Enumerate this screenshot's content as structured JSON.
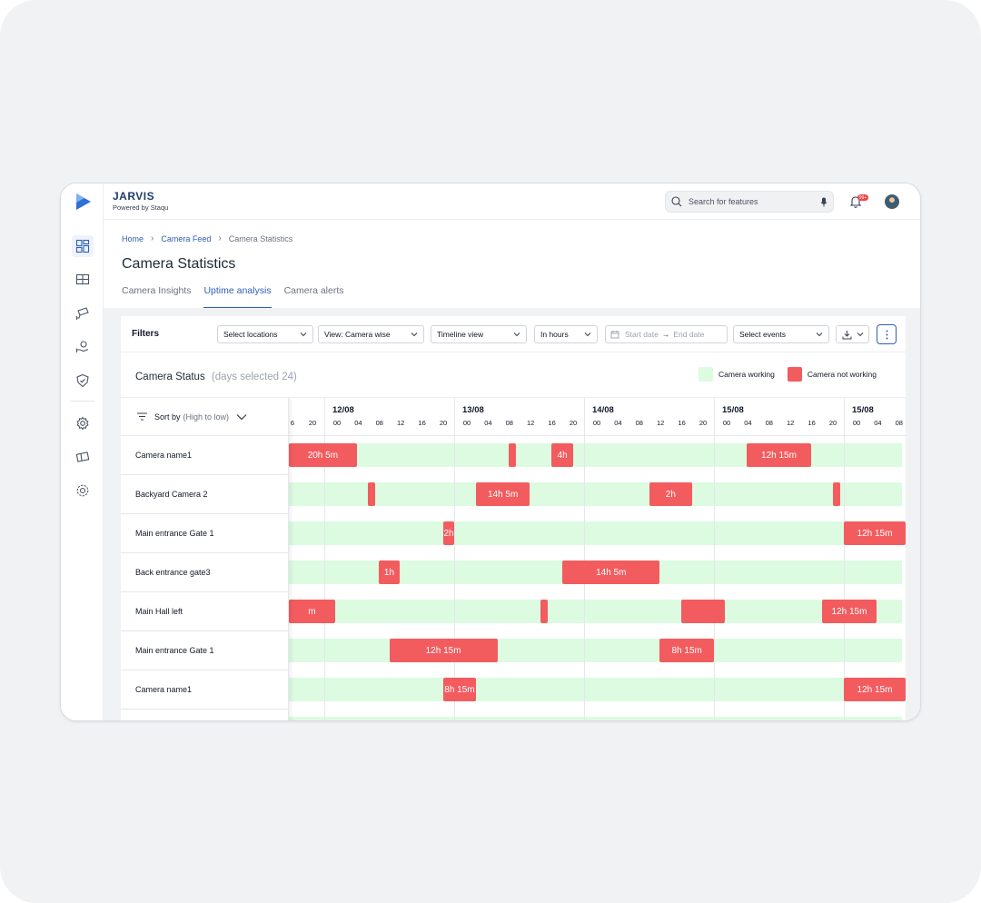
{
  "app": {
    "title": "JARVIS",
    "subtitle": "Powered by Staqu"
  },
  "search": {
    "placeholder": "Search for features"
  },
  "notifications": {
    "badge": "99+"
  },
  "breadcrumb": {
    "home": "Home",
    "feed": "Camera Feed",
    "current": "Camera Statistics"
  },
  "page": {
    "title": "Camera Statistics"
  },
  "tabs": [
    {
      "label": "Camera Insights",
      "active": false
    },
    {
      "label": "Uptime analysis",
      "active": true
    },
    {
      "label": "Camera alerts",
      "active": false
    }
  ],
  "filters": {
    "label": "Filters",
    "locations": "Select locations",
    "view": "View: Camera wise",
    "mode": "Timeline view",
    "unit": "In hours",
    "start_date": "Start date",
    "end_date": "End date",
    "events": "Select events"
  },
  "status": {
    "title": "Camera Status",
    "days": "(days selected 24)"
  },
  "legend": {
    "working": {
      "label": "Camera working",
      "color": "#dcfbe1"
    },
    "not_working": {
      "label": "Camera not working",
      "color": "#f25c5f"
    }
  },
  "sort": {
    "label": "Sort by",
    "order": "(High to low)"
  },
  "timeline": {
    "partial_hours": [
      "6",
      "20"
    ],
    "days": [
      {
        "date": "12/08",
        "hours": [
          "00",
          "04",
          "08",
          "12",
          "16",
          "20"
        ]
      },
      {
        "date": "13/08",
        "hours": [
          "00",
          "04",
          "08",
          "12",
          "16",
          "20"
        ]
      },
      {
        "date": "14/08",
        "hours": [
          "00",
          "04",
          "08",
          "12",
          "16",
          "20"
        ]
      },
      {
        "date": "15/08",
        "hours": [
          "00",
          "04",
          "08",
          "12",
          "16",
          "20"
        ]
      },
      {
        "date": "15/08",
        "hours": [
          "00",
          "04",
          "08"
        ]
      }
    ]
  },
  "cameras": [
    {
      "name": "Camera name1",
      "outages": [
        {
          "start": "11/08 14:00",
          "end": "12/08 06:00",
          "label": "20h 5m"
        },
        {
          "start": "13/08 10:00",
          "end": "13/08 11:00",
          "label": ""
        },
        {
          "start": "13/08 18:00",
          "end": "13/08 22:00",
          "label": "4h"
        },
        {
          "start": "15/08 06:00",
          "end": "15/08 18:00",
          "label": "12h 15m"
        }
      ]
    },
    {
      "name": "Backyard Camera 2",
      "outages": [
        {
          "start": "12/08 08:00",
          "end": "12/08 09:00",
          "label": ""
        },
        {
          "start": "13/08 04:00",
          "end": "13/08 14:00",
          "label": "14h 5m"
        },
        {
          "start": "14/08 12:00",
          "end": "14/08 20:00",
          "label": "2h"
        },
        {
          "start": "15/08 22:00",
          "end": "15/08 23:00",
          "label": ""
        }
      ]
    },
    {
      "name": "Main entrance Gate 1",
      "outages": [
        {
          "start": "12/08 22:00",
          "end": "13/08 00:00",
          "label": "2h"
        },
        {
          "start": "16/08 00:00",
          "end": "16/08 12:00",
          "label": "12h 15m"
        }
      ]
    },
    {
      "name": "Back entrance gate3",
      "outages": [
        {
          "start": "12/08 10:00",
          "end": "12/08 14:00",
          "label": "1h"
        },
        {
          "start": "13/08 20:00",
          "end": "14/08 14:00",
          "label": "14h 5m"
        }
      ]
    },
    {
      "name": "Main Hall left",
      "outages": [
        {
          "start": "11/08 10:00",
          "end": "12/08 02:00",
          "label": "m"
        },
        {
          "start": "13/08 16:00",
          "end": "13/08 17:00",
          "label": ""
        },
        {
          "start": "14/08 18:00",
          "end": "15/08 02:00",
          "label": ""
        },
        {
          "start": "15/08 20:00",
          "end": "16/08 06:00",
          "label": "12h 15m"
        }
      ]
    },
    {
      "name": "Main entrance Gate 1",
      "outages": [
        {
          "start": "12/08 12:00",
          "end": "13/08 08:00",
          "label": "12h 15m"
        },
        {
          "start": "14/08 14:00",
          "end": "15/08 00:00",
          "label": "8h 15m"
        }
      ]
    },
    {
      "name": "Camera name1",
      "outages": [
        {
          "start": "12/08 22:00",
          "end": "13/08 04:00",
          "label": "8h 15m"
        },
        {
          "start": "16/08 00:00",
          "end": "16/08 12:00",
          "label": "12h 15m"
        }
      ]
    }
  ]
}
